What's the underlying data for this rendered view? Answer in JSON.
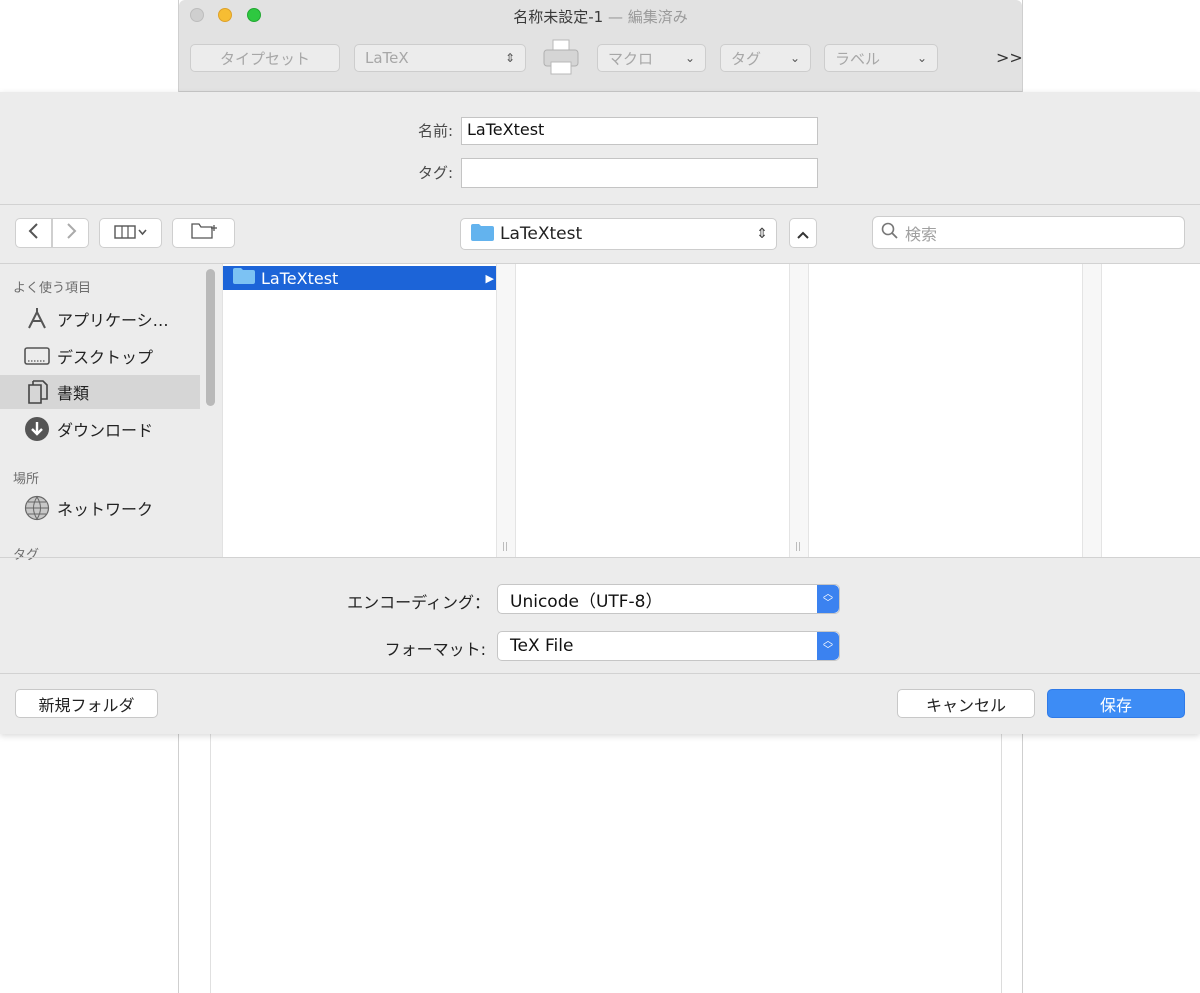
{
  "window": {
    "title": "名称未設定-1",
    "title_suffix": "— 編集済み",
    "toolbar": {
      "typeset": "タイプセット",
      "engine": "LaTeX",
      "macro": "マクロ",
      "tag": "タグ",
      "label": "ラベル",
      "overflow": ">>"
    }
  },
  "save": {
    "name_label": "名前:",
    "name_value": "LaTeXtest",
    "tags_label": "タグ:",
    "tags_value": "",
    "location": "LaTeXtest",
    "search_placeholder": "検索"
  },
  "sidebar": {
    "favorites_header": "よく使う項目",
    "favorites": [
      {
        "label": "アプリケーシ…",
        "icon": "applications-icon"
      },
      {
        "label": "デスクトップ",
        "icon": "desktop-icon"
      },
      {
        "label": "書類",
        "icon": "documents-icon",
        "selected": true
      },
      {
        "label": "ダウンロード",
        "icon": "downloads-icon"
      }
    ],
    "locations_header": "場所",
    "locations": [
      {
        "label": "ネットワーク",
        "icon": "network-icon"
      }
    ],
    "tags_header": "タグ"
  },
  "browser": {
    "column1": [
      {
        "label": "LaTeXtest",
        "selected": true,
        "has_children": true
      }
    ]
  },
  "options": {
    "encoding_label": "エンコーディング：",
    "encoding_value": "Unicode（UTF-8）",
    "format_label": "フォーマット:",
    "format_value": "TeX File"
  },
  "buttons": {
    "new_folder": "新規フォルダ",
    "cancel": "キャンセル",
    "save": "保存"
  },
  "colors": {
    "accent": "#3d8cf5",
    "selection": "#1c64d8",
    "folder": "#63b3ee",
    "close": "#cfcfcf",
    "minimize": "#f6bd33",
    "zoom": "#2ec840"
  }
}
